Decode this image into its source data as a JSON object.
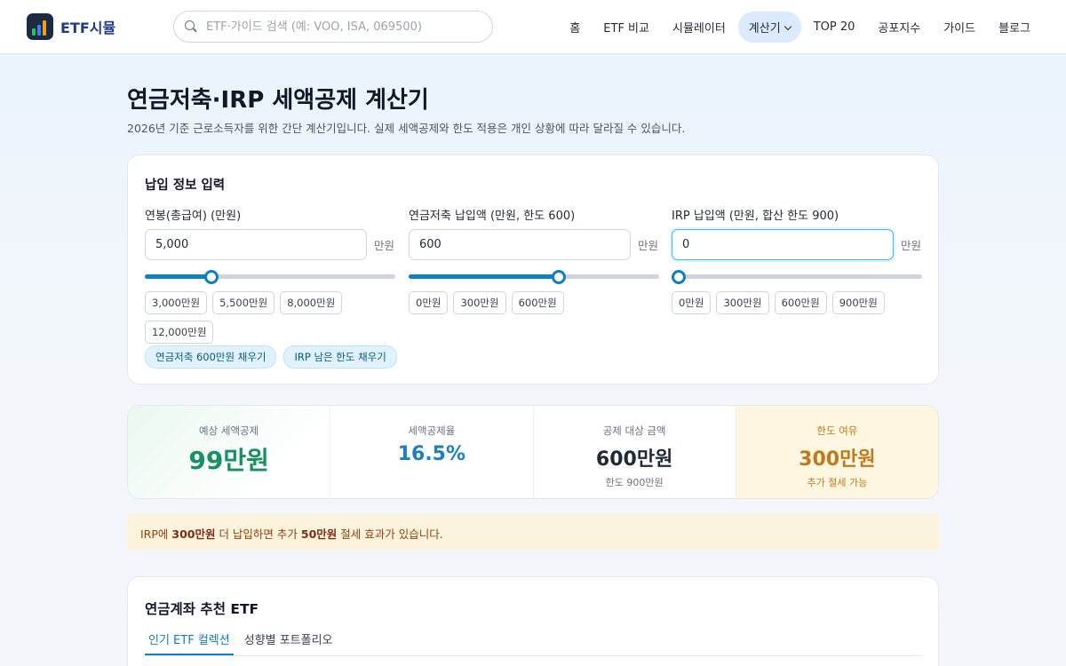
{
  "header": {
    "brand": "ETF시뮬",
    "search_placeholder": "ETF·가이드 검색 (예: VOO, ISA, 069500)",
    "nav": [
      "홈",
      "ETF 비교",
      "시뮬레이터",
      "계산기",
      "TOP 20",
      "공포지수",
      "가이드",
      "블로그"
    ],
    "active_nav": "계산기"
  },
  "page": {
    "title": "연금저축·IRP 세액공제 계산기",
    "subtitle": "2026년 기준 근로소득자를 위한 간단 계산기입니다. 실제 세액공제와 한도 적용은 개인 상황에 따라 달라질 수 있습니다."
  },
  "input_card": {
    "title": "납입 정보 입력",
    "unit": "만원",
    "fields": [
      {
        "label": "연봉(총급여) (만원)",
        "value": "5,000",
        "slider_fraction": 0.267,
        "chips": [
          "3,000만원",
          "5,500만원",
          "8,000만원",
          "12,000만원"
        ]
      },
      {
        "label": "연금저축 납입액 (만원, 한도 600)",
        "value": "600",
        "slider_fraction": 0.6,
        "chips": [
          "0만원",
          "300만원",
          "600만원"
        ]
      },
      {
        "label": "IRP 납입액 (만원, 합산 한도 900)",
        "value": "0",
        "slider_fraction": 0.0,
        "chips": [
          "0만원",
          "300만원",
          "600만원",
          "900만원"
        ]
      }
    ],
    "quick_buttons": [
      "연금저축 600만원 채우기",
      "IRP 남은 한도 채우기"
    ]
  },
  "stats": [
    {
      "label": "예상 세액공제",
      "value": "99만원",
      "sub": ""
    },
    {
      "label": "세액공제율",
      "value": "16.5%",
      "sub": ""
    },
    {
      "label": "공제 대상 금액",
      "value": "600만원",
      "sub": "한도 900만원"
    },
    {
      "label": "한도 여유",
      "value": "300만원",
      "sub": "추가 절세 가능"
    }
  ],
  "tip": {
    "prefix": "IRP에 ",
    "amount1": "300만원",
    "middle": " 더 납입하면 추가 ",
    "amount2": "50만원",
    "suffix": " 절세 효과가 있습니다."
  },
  "etf_section": {
    "title": "연금계좌 추천 ETF",
    "tabs": [
      "인기 ETF 컬렉션",
      "성향별 포트폴리오"
    ]
  },
  "colors": {
    "accent": "#0e7fc0",
    "green": "#16915f",
    "amber": "#c2791b"
  }
}
